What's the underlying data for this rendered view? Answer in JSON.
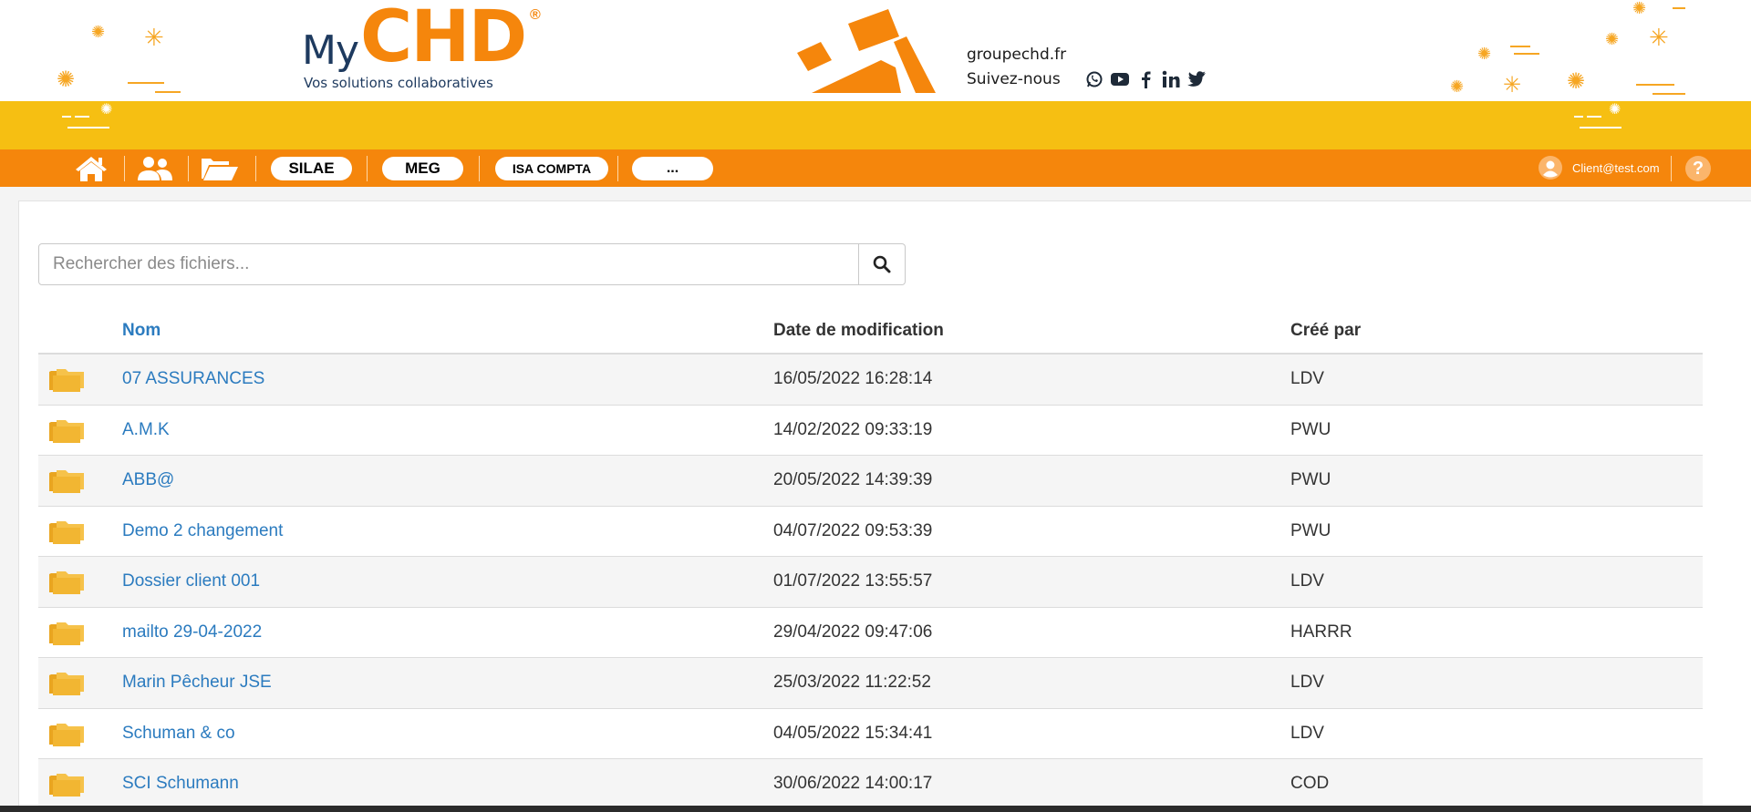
{
  "header": {
    "logo_prefix": "My",
    "logo_main": "CHD",
    "logo_reg": "®",
    "tagline": "Vos solutions collaboratives",
    "site_url": "groupechd.fr",
    "follow_label": "Suivez-nous",
    "social_icons": [
      "whatsapp-icon",
      "youtube-icon",
      "facebook-icon",
      "linkedin-icon",
      "twitter-icon"
    ]
  },
  "nav": {
    "icons": [
      "home-icon",
      "users-icon",
      "folder-open-icon"
    ],
    "apps": [
      "SILAE",
      "MEG",
      "ISA COMPTA",
      "..."
    ],
    "user_email": "Client@test.com",
    "help_label": "?"
  },
  "search": {
    "placeholder": "Rechercher des fichiers..."
  },
  "table": {
    "columns": [
      "Nom",
      "Date de modification",
      "Créé par"
    ],
    "rows": [
      {
        "name": "07 ASSURANCES",
        "date": "16/05/2022 16:28:14",
        "author": "LDV"
      },
      {
        "name": "A.M.K",
        "date": "14/02/2022 09:33:19",
        "author": "PWU"
      },
      {
        "name": "ABB@",
        "date": "20/05/2022 14:39:39",
        "author": "PWU"
      },
      {
        "name": "Demo 2 changement",
        "date": "04/07/2022 09:53:39",
        "author": "PWU"
      },
      {
        "name": "Dossier client 001",
        "date": "01/07/2022 13:55:57",
        "author": "LDV"
      },
      {
        "name": "mailto 29-04-2022",
        "date": "29/04/2022 09:47:06",
        "author": "HARRR"
      },
      {
        "name": "Marin Pêcheur JSE",
        "date": "25/03/2022 11:22:52",
        "author": "LDV"
      },
      {
        "name": "Schuman & co",
        "date": "04/05/2022 15:34:41",
        "author": "LDV"
      },
      {
        "name": "SCI Schumann",
        "date": "30/06/2022 14:00:17",
        "author": "COD"
      }
    ]
  },
  "colors": {
    "orange": "#f5860c",
    "yellow": "#f6bf12",
    "link_blue": "#2b7bbf",
    "folder_yellow": "#f2b632"
  }
}
